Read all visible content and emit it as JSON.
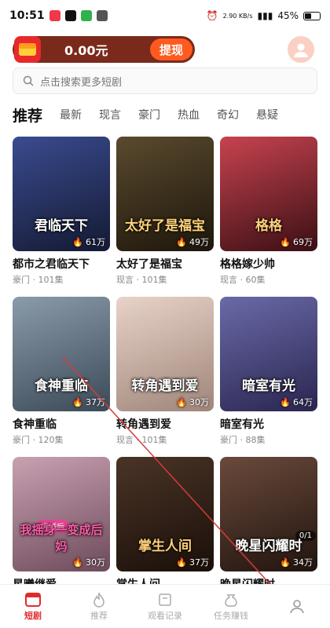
{
  "status": {
    "time": "10:51",
    "network": "2.90 KB/s",
    "battery": "45%",
    "battery_level": 0.45
  },
  "wallet": {
    "amount": "0.00元",
    "withdraw_label": "提现"
  },
  "search": {
    "placeholder": "点击搜索更多短剧"
  },
  "tabs": [
    "推荐",
    "最新",
    "现言",
    "豪门",
    "热血",
    "奇幻",
    "悬疑"
  ],
  "dramas": [
    {
      "title": "都市之君临天下",
      "genre": "豪门",
      "episodes": "101集",
      "views": "61万",
      "poster_text": "君临天下",
      "colors": [
        "#3a4b8f",
        "#141a33"
      ]
    },
    {
      "title": "太好了是福宝",
      "genre": "现言",
      "episodes": "101集",
      "views": "49万",
      "poster_text": "太好了是福宝",
      "colors": [
        "#5a4a2e",
        "#1d160b"
      ]
    },
    {
      "title": "格格嫁少帅",
      "genre": "现言",
      "episodes": "60集",
      "views": "69万",
      "poster_text": "格格",
      "colors": [
        "#c7434f",
        "#3a0f14"
      ]
    },
    {
      "title": "食神重临",
      "genre": "豪门",
      "episodes": "120集",
      "views": "37万",
      "poster_text": "食神重临",
      "colors": [
        "#8a9bab",
        "#3c4a57"
      ]
    },
    {
      "title": "转角遇到爱",
      "genre": "现言",
      "episodes": "101集",
      "views": "30万",
      "poster_text": "转角遇到爱",
      "colors": [
        "#e8d3c8",
        "#9f857a"
      ]
    },
    {
      "title": "暗室有光",
      "genre": "豪门",
      "episodes": "88集",
      "views": "64万",
      "poster_text": "暗室有光",
      "colors": [
        "#6a6aa8",
        "#2a2550"
      ]
    },
    {
      "title": "星曦继爱",
      "genre": "",
      "episodes": "",
      "views": "30万",
      "poster_text": "我摇身一变成后妈",
      "colors": [
        "#c9a2b2",
        "#6d4a5a"
      ]
    },
    {
      "title": "掌生人间",
      "genre": "",
      "episodes": "",
      "views": "37万",
      "poster_text": "掌生人间",
      "colors": [
        "#4a3427",
        "#1a0f09"
      ]
    },
    {
      "title": "晚星闪耀时",
      "genre": "",
      "episodes": "",
      "views": "34万",
      "poster_text": "晚星闪耀时",
      "colors": [
        "#6a4a3c",
        "#21140e"
      ]
    }
  ],
  "extras": {
    "badge_text": "闪婚后",
    "chip_text": "0/1"
  },
  "nav": [
    {
      "label": "短剧",
      "icon": "drama-icon",
      "active": true
    },
    {
      "label": "推荐",
      "icon": "flame-icon",
      "active": false
    },
    {
      "label": "观看记录",
      "icon": "history-icon",
      "active": false
    },
    {
      "label": "任务赚钱",
      "icon": "coin-bag-icon",
      "active": false
    },
    {
      "label": "",
      "icon": "profile-icon",
      "active": false
    }
  ]
}
